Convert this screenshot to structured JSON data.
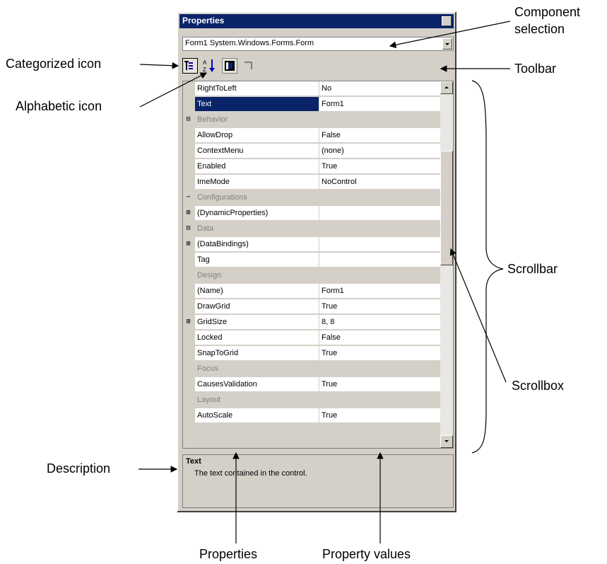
{
  "window": {
    "title": "Properties",
    "component_selection": "Form1  System.Windows.Forms.Form"
  },
  "toolbar": {
    "categorized_icon": "categorized-icon",
    "alphabetic_icon": "alphabetic-icon",
    "properties_icon": "properties-icon",
    "events_icon": "events-icon"
  },
  "grid": {
    "rows": [
      {
        "type": "prop",
        "name": "RightToLeft",
        "value": "No",
        "expander": ""
      },
      {
        "type": "prop",
        "name": "Text",
        "value": "Form1",
        "expander": "",
        "selected": true
      },
      {
        "type": "cat",
        "name": "Behavior",
        "expander": "⊟"
      },
      {
        "type": "prop",
        "name": "AllowDrop",
        "value": "False",
        "expander": ""
      },
      {
        "type": "prop",
        "name": "ContextMenu",
        "value": "(none)",
        "expander": ""
      },
      {
        "type": "prop",
        "name": "Enabled",
        "value": "True",
        "expander": ""
      },
      {
        "type": "prop",
        "name": "ImeMode",
        "value": "NoControl",
        "expander": ""
      },
      {
        "type": "cat",
        "name": "Configurations",
        "expander": "−"
      },
      {
        "type": "prop",
        "name": "(DynamicProperties)",
        "value": "",
        "expander": "⊞"
      },
      {
        "type": "cat",
        "name": "Data",
        "expander": "⊟"
      },
      {
        "type": "prop",
        "name": "(DataBindings)",
        "value": "",
        "expander": "⊞"
      },
      {
        "type": "prop",
        "name": "Tag",
        "value": "",
        "expander": ""
      },
      {
        "type": "cat",
        "name": "Design",
        "expander": ""
      },
      {
        "type": "prop",
        "name": "(Name)",
        "value": "Form1",
        "expander": ""
      },
      {
        "type": "prop",
        "name": "DrawGrid",
        "value": "True",
        "expander": ""
      },
      {
        "type": "prop",
        "name": "GridSize",
        "value": "8, 8",
        "expander": "⊞"
      },
      {
        "type": "prop",
        "name": "Locked",
        "value": "False",
        "expander": ""
      },
      {
        "type": "prop",
        "name": "SnapToGrid",
        "value": "True",
        "expander": ""
      },
      {
        "type": "cat",
        "name": "Focus",
        "expander": ""
      },
      {
        "type": "prop",
        "name": "CausesValidation",
        "value": "True",
        "expander": ""
      },
      {
        "type": "cat",
        "name": "Layout",
        "expander": ""
      },
      {
        "type": "prop",
        "name": "AutoScale",
        "value": "True",
        "expander": ""
      }
    ]
  },
  "description": {
    "title": "Text",
    "body": "The text contained in the control."
  },
  "callouts": {
    "component_selection_line1": "Component",
    "component_selection_line2": "selection",
    "toolbar": "Toolbar",
    "categorized_icon": "Categorized icon",
    "alphabetic_icon": "Alphabetic icon",
    "scrollbar": "Scrollbar",
    "scrollbox": "Scrollbox",
    "description": "Description",
    "properties": "Properties",
    "property_values": "Property values"
  },
  "colors": {
    "title_bar": "#0a246a",
    "selection": "#0a246a",
    "panel": "#d4d0c8"
  }
}
